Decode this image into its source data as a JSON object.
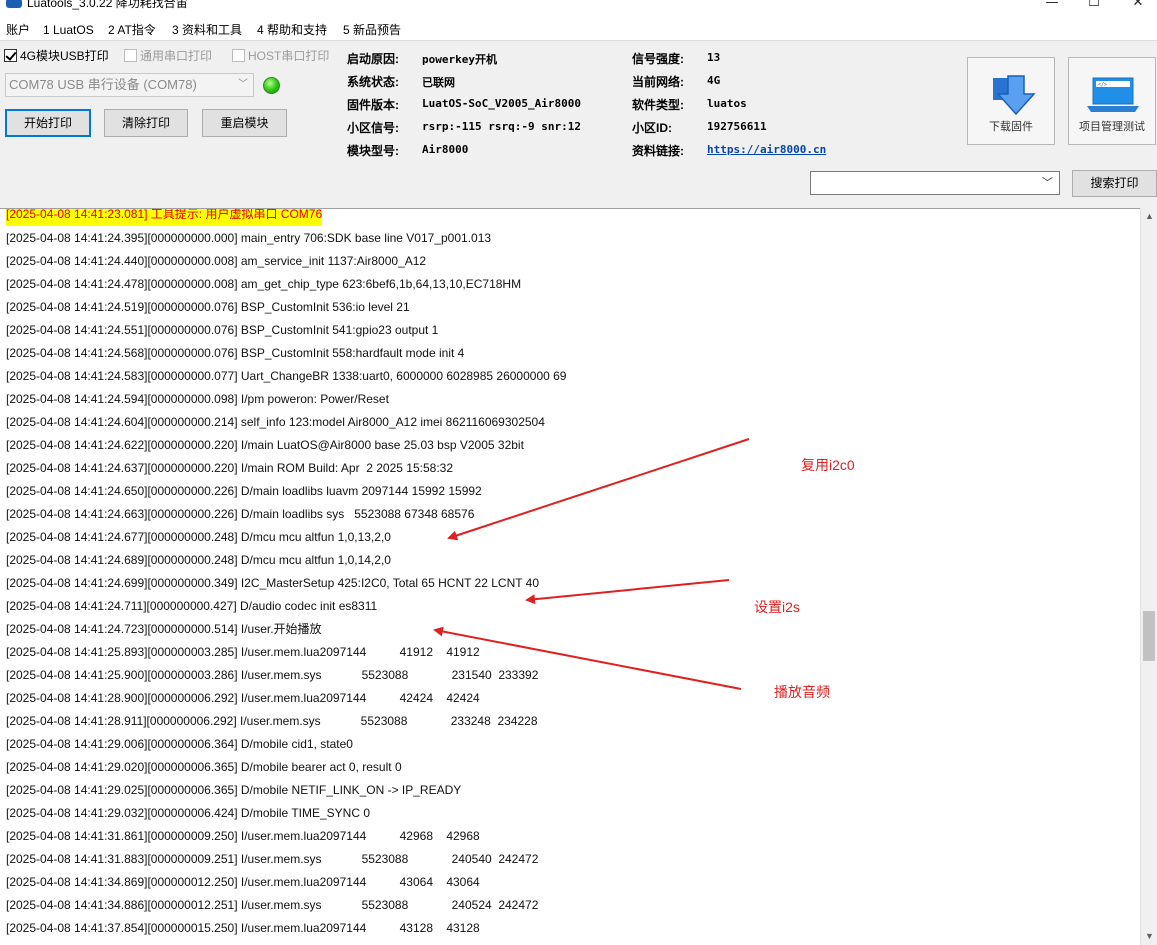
{
  "window": {
    "title": "Luatools_3.0.22 降功耗找合宙",
    "minimize": "—",
    "maximize": "☐",
    "close": "✕"
  },
  "menu": [
    "账户",
    "1 LuatOS",
    "2 AT指令",
    "3 资料和工具",
    "4 帮助和支持",
    "5 新品预告"
  ],
  "options": {
    "usb_print": "4G模块USB打印",
    "serial_print": "通用串口打印",
    "host_print": "HOST串口打印"
  },
  "port": {
    "selected": "COM78 USB 串行设备 (COM78)"
  },
  "buttons": {
    "start_print": "开始打印",
    "clear_print": "清除打印",
    "restart_module": "重启模块",
    "download_firmware": "下载固件",
    "project_test": "项目管理测试",
    "search_print": "搜索打印"
  },
  "info": {
    "boot_reason_label": "启动原因:",
    "boot_reason": "powerkey开机",
    "system_status_label": "系统状态:",
    "system_status": "已联网",
    "firmware_label": "固件版本:",
    "firmware": "LuatOS-SoC_V2005_Air8000",
    "cell_signal_label": "小区信号:",
    "cell_signal": "rsrp:-115 rsrq:-9 snr:12",
    "module_model_label": "模块型号:",
    "module_model": "Air8000",
    "signal_strength_label": "信号强度:",
    "signal_strength": "13",
    "current_network_label": "当前网络:",
    "current_network": "4G",
    "software_type_label": "软件类型:",
    "software_type": "luatos",
    "cell_id_label": "小区ID:",
    "cell_id": "192756611",
    "docs_link_label": "资料链接:",
    "docs_link": "https://air8000.cn"
  },
  "log": {
    "highlight": "[2025-04-08 14:41:23.081] 工具提示: 用户虚拟串口 COM76",
    "lines": [
      "[2025-04-08 14:41:24.395][000000000.000] main_entry 706:SDK base line V017_p001.013",
      "[2025-04-08 14:41:24.440][000000000.008] am_service_init 1137:Air8000_A12",
      "[2025-04-08 14:41:24.478][000000000.008] am_get_chip_type 623:6bef6,1b,64,13,10,EC718HM",
      "[2025-04-08 14:41:24.519][000000000.076] BSP_CustomInit 536:io level 21",
      "[2025-04-08 14:41:24.551][000000000.076] BSP_CustomInit 541:gpio23 output 1",
      "[2025-04-08 14:41:24.568][000000000.076] BSP_CustomInit 558:hardfault mode init 4",
      "[2025-04-08 14:41:24.583][000000000.077] Uart_ChangeBR 1338:uart0, 6000000 6028985 26000000 69",
      "[2025-04-08 14:41:24.594][000000000.098] I/pm poweron: Power/Reset",
      "[2025-04-08 14:41:24.604][000000000.214] self_info 123:model Air8000_A12 imei 862116069302504",
      "[2025-04-08 14:41:24.622][000000000.220] I/main LuatOS@Air8000 base 25.03 bsp V2005 32bit",
      "[2025-04-08 14:41:24.637][000000000.220] I/main ROM Build: Apr  2 2025 15:58:32",
      "[2025-04-08 14:41:24.650][000000000.226] D/main loadlibs luavm 2097144 15992 15992",
      "[2025-04-08 14:41:24.663][000000000.226] D/main loadlibs sys   5523088 67348 68576",
      "[2025-04-08 14:41:24.677][000000000.248] D/mcu mcu altfun 1,0,13,2,0",
      "[2025-04-08 14:41:24.689][000000000.248] D/mcu mcu altfun 1,0,14,2,0",
      "[2025-04-08 14:41:24.699][000000000.349] I2C_MasterSetup 425:I2C0, Total 65 HCNT 22 LCNT 40",
      "[2025-04-08 14:41:24.711][000000000.427] D/audio codec init es8311",
      "[2025-04-08 14:41:24.723][000000000.514] I/user.开始播放",
      "[2025-04-08 14:41:25.893][000000003.285] I/user.mem.lua2097144          41912    41912",
      "[2025-04-08 14:41:25.900][000000003.286] I/user.mem.sys            5523088             231540  233392",
      "[2025-04-08 14:41:28.900][000000006.292] I/user.mem.lua2097144          42424    42424",
      "[2025-04-08 14:41:28.911][000000006.292] I/user.mem.sys            5523088             233248  234228",
      "[2025-04-08 14:41:29.006][000000006.364] D/mobile cid1, state0",
      "[2025-04-08 14:41:29.020][000000006.365] D/mobile bearer act 0, result 0",
      "[2025-04-08 14:41:29.025][000000006.365] D/mobile NETIF_LINK_ON -> IP_READY",
      "[2025-04-08 14:41:29.032][000000006.424] D/mobile TIME_SYNC 0",
      "[2025-04-08 14:41:31.861][000000009.250] I/user.mem.lua2097144          42968    42968",
      "[2025-04-08 14:41:31.883][000000009.251] I/user.mem.sys            5523088             240540  242472",
      "[2025-04-08 14:41:34.869][000000012.250] I/user.mem.lua2097144          43064    43064",
      "[2025-04-08 14:41:34.886][000000012.251] I/user.mem.sys            5523088             240524  242472",
      "[2025-04-08 14:41:37.854][000000015.250] I/user.mem.lua2097144          43128    43128"
    ]
  },
  "annotations": {
    "reuse_i2c0": "复用i2c0",
    "set_i2s": "设置i2s",
    "play_audio": "播放音频"
  },
  "colors": {
    "annotation": "#e02020",
    "highlight_bg": "#ffff00",
    "highlight_text": "#e60000",
    "focus_border": "#0078d7",
    "link": "#0645ad"
  },
  "icons": {
    "app": "luatools-logo-icon",
    "download": "download-arrow-icon",
    "project": "laptop-code-icon",
    "status": "green-status-led-icon"
  }
}
